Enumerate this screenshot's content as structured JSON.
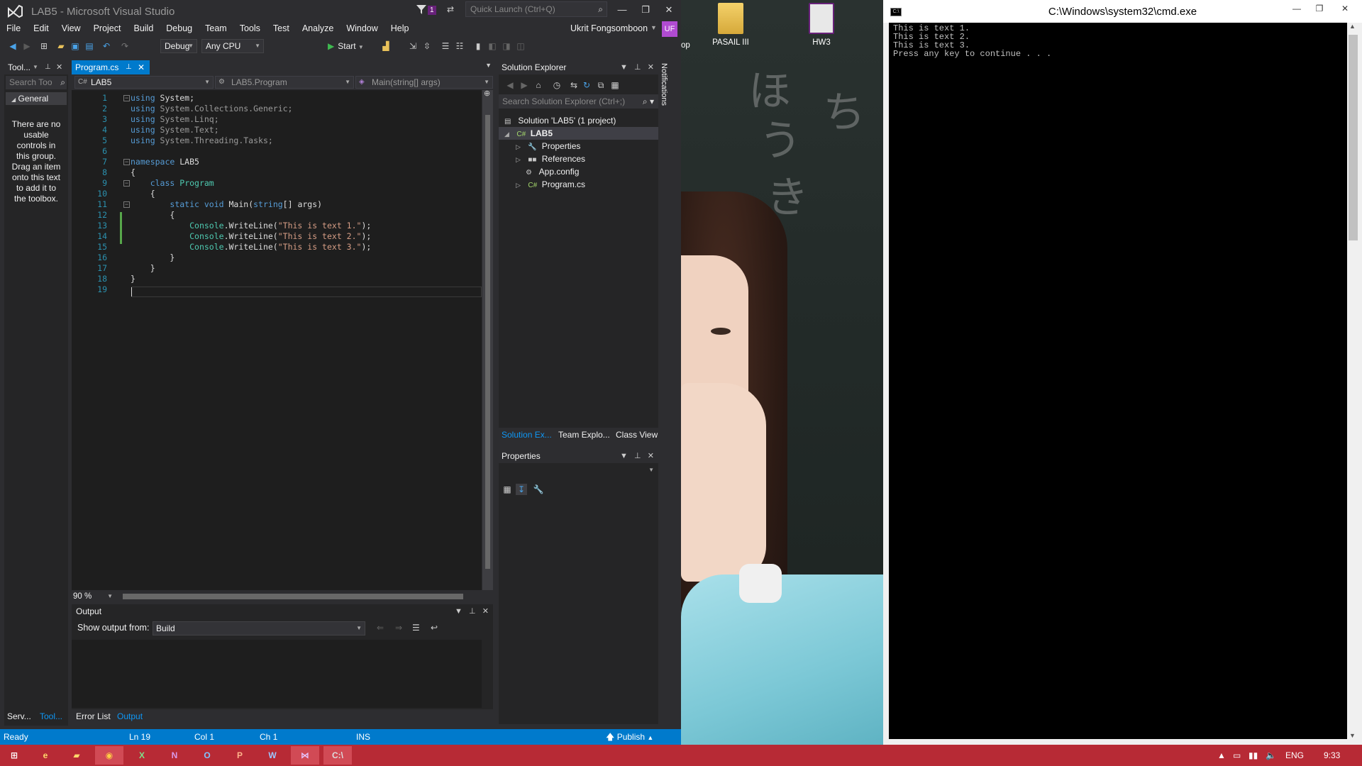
{
  "vs": {
    "title": "LAB5 - Microsoft Visual Studio",
    "filter_count": "1",
    "quick_launch_placeholder": "Quick Launch (Ctrl+Q)",
    "menu": [
      "File",
      "Edit",
      "View",
      "Project",
      "Build",
      "Debug",
      "Team",
      "Tools",
      "Test",
      "Analyze",
      "Window",
      "Help"
    ],
    "user_name": "Ukrit Fongsomboon",
    "user_initials": "UF",
    "toolbar": {
      "config": "Debug",
      "platform": "Any CPU",
      "start_label": "Start"
    },
    "toolbox": {
      "title": "Tool...",
      "search_placeholder": "Search Too",
      "group": "General",
      "empty_message": "There are no usable controls in this group. Drag an item onto this text to add it to the toolbox."
    },
    "editor": {
      "tab_label": "Program.cs",
      "nav_project": "LAB5",
      "nav_class": "LAB5.Program",
      "nav_member": "Main(string[] args)",
      "line_numbers": [
        "1",
        "2",
        "3",
        "4",
        "5",
        "6",
        "7",
        "8",
        "9",
        "10",
        "11",
        "12",
        "13",
        "14",
        "15",
        "16",
        "17",
        "18",
        "19"
      ],
      "lines": [
        "using System;",
        "using System.Collections.Generic;",
        "using System.Linq;",
        "using System.Text;",
        "using System.Threading.Tasks;",
        "",
        "namespace LAB5",
        "{",
        "    class Program",
        "    {",
        "        static void Main(string[] args)",
        "        {",
        "            Console.WriteLine(\"This is text 1.\");",
        "            Console.WriteLine(\"This is text 2.\");",
        "            Console.WriteLine(\"This is text 3.\");",
        "        }",
        "    }",
        "}",
        ""
      ],
      "zoom": "90 %"
    },
    "output": {
      "title": "Output",
      "show_from_label": "Show output from:",
      "source": "Build"
    },
    "bottom_tabs": [
      "Error List",
      "Output"
    ],
    "left_bottom_tabs": [
      "Serv...",
      "Tool..."
    ],
    "solution_explorer": {
      "title": "Solution Explorer",
      "search_placeholder": "Search Solution Explorer (Ctrl+;)",
      "solution": "Solution 'LAB5' (1 project)",
      "project": "LAB5",
      "items": [
        "Properties",
        "References",
        "App.config",
        "Program.cs"
      ],
      "tabs": [
        "Solution Ex...",
        "Team Explo...",
        "Class View"
      ]
    },
    "properties": {
      "title": "Properties"
    },
    "notifications": "Notifications",
    "status": {
      "ready": "Ready",
      "ln": "Ln 19",
      "col": "Col 1",
      "ch": "Ch 1",
      "ins": "INS",
      "publish": "Publish"
    }
  },
  "desktop": {
    "icons": [
      "PASAIL III",
      "HW3"
    ],
    "partial_icon": "op"
  },
  "cmd": {
    "title": "C:\\Windows\\system32\\cmd.exe",
    "lines": [
      "This is text 1.",
      "This is text 2.",
      "This is text 3.",
      "Press any key to continue . . ."
    ]
  },
  "taskbar": {
    "apps": [
      "start",
      "internet-explorer",
      "file-explorer",
      "chrome",
      "excel",
      "onenote",
      "outlook",
      "powerpoint",
      "word",
      "visual-studio",
      "cmd"
    ],
    "language": "ENG",
    "time": "9:33"
  },
  "colors": {
    "vs_accent": "#007acc",
    "taskbar": "#b72a35",
    "keyword": "#569cd6",
    "type": "#4ec9b0",
    "string": "#d69d85"
  }
}
